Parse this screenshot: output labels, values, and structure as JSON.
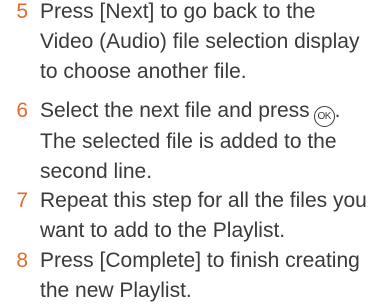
{
  "steps": [
    {
      "number": "5",
      "text": "Press [Next] to go back to the\nVideo (Audio) file selection display\nto choose another file."
    },
    {
      "number": "6",
      "text_before_icon": "Select the next file and press",
      "icon": "ok-button-icon",
      "icon_label": "OK",
      "text_after_icon": ".\nThe selected file is added to the\nsecond line."
    },
    {
      "number": "7",
      "text": "Repeat this step for all the files you\nwant to add to the Playlist."
    },
    {
      "number": "8",
      "text": "Press [Complete] to finish creating\nthe new Playlist."
    }
  ],
  "colors": {
    "step_number": "#e36a2e",
    "body_text": "#3a3a3a"
  }
}
